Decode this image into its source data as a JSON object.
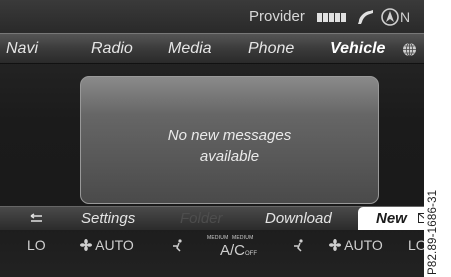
{
  "status_bar": {
    "provider_label": "Provider",
    "signal_strength": 5,
    "phone_icon": "phone-handset-icon",
    "nav_icon": "navigation-arrow-icon",
    "compass": "N"
  },
  "main_menu": {
    "items": [
      {
        "label": "Navi",
        "active": false
      },
      {
        "label": "Radio",
        "active": false
      },
      {
        "label": "Media",
        "active": false
      },
      {
        "label": "Phone",
        "active": false
      },
      {
        "label": "Vehicle",
        "active": true
      }
    ],
    "globe_icon": "globe-icon"
  },
  "message": {
    "line1": "No new messages",
    "line2": "available"
  },
  "bottom_menu": {
    "back_icon": "back-arrow-icon",
    "items": [
      {
        "label": "Settings",
        "enabled": true
      },
      {
        "label": "Folder",
        "enabled": false
      },
      {
        "label": "Download",
        "enabled": true
      }
    ],
    "new_label": "New",
    "new_icon": "envelope-icon"
  },
  "climate": {
    "left_temp": "LO",
    "left_fan": "AUTO",
    "medium_left": "MEDIUM",
    "medium_right": "MEDIUM",
    "ac_label": "A/C",
    "ac_state": "OFF",
    "right_fan": "AUTO",
    "right_temp": "LO"
  },
  "reference_code": "P82.89-1686-31",
  "colors": {
    "screen_background": "#1b1b1b",
    "text": "#e6e6e6",
    "highlight": "#ffffff"
  }
}
